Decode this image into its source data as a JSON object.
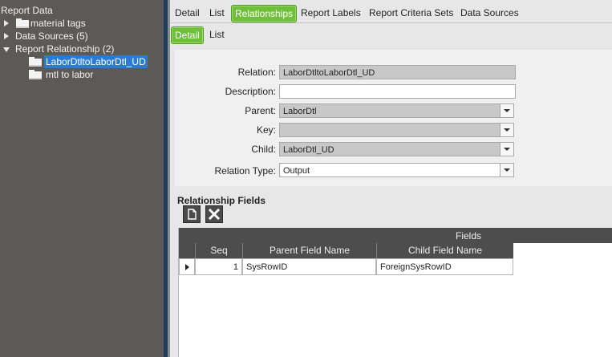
{
  "tree": {
    "root_label": "Report Data",
    "items": [
      {
        "label": "material tags"
      },
      {
        "label": "Data Sources (5)"
      },
      {
        "label": "Report Relationship (2)"
      }
    ],
    "children": [
      {
        "label": "LaborDtltoLaborDtl_UD",
        "selected": true
      },
      {
        "label": "mtl to labor",
        "selected": false
      }
    ]
  },
  "tabs": {
    "top": [
      "Detail",
      "List",
      "Relationships",
      "Report Labels",
      "Report Criteria Sets",
      "Data Sources"
    ],
    "top_active": "Relationships",
    "sub": [
      "Detail",
      "List"
    ],
    "sub_active": "Detail",
    "active_color": "#6fbf3a"
  },
  "form": {
    "relation_label": "Relation:",
    "relation_value": "LaborDtltoLaborDtl_UD",
    "description_label": "Description:",
    "description_value": "",
    "parent_label": "Parent:",
    "parent_value": "LaborDtl",
    "key_label": "Key:",
    "key_value": "",
    "child_label": "Child:",
    "child_value": "LaborDtl_UD",
    "relation_type_label": "Relation Type:",
    "relation_type_value": "Output"
  },
  "relationship_fields": {
    "title": "Relationship Fields",
    "new_button_icon": "new-page-icon",
    "delete_button_icon": "close-x-icon"
  },
  "grid": {
    "band_title": "Fields",
    "columns": [
      "Seq",
      "Parent Field Name",
      "Child Field Name"
    ],
    "rows": [
      {
        "seq": "1",
        "parent": "SysRowID",
        "child": "ForeignSysRowID"
      }
    ]
  }
}
